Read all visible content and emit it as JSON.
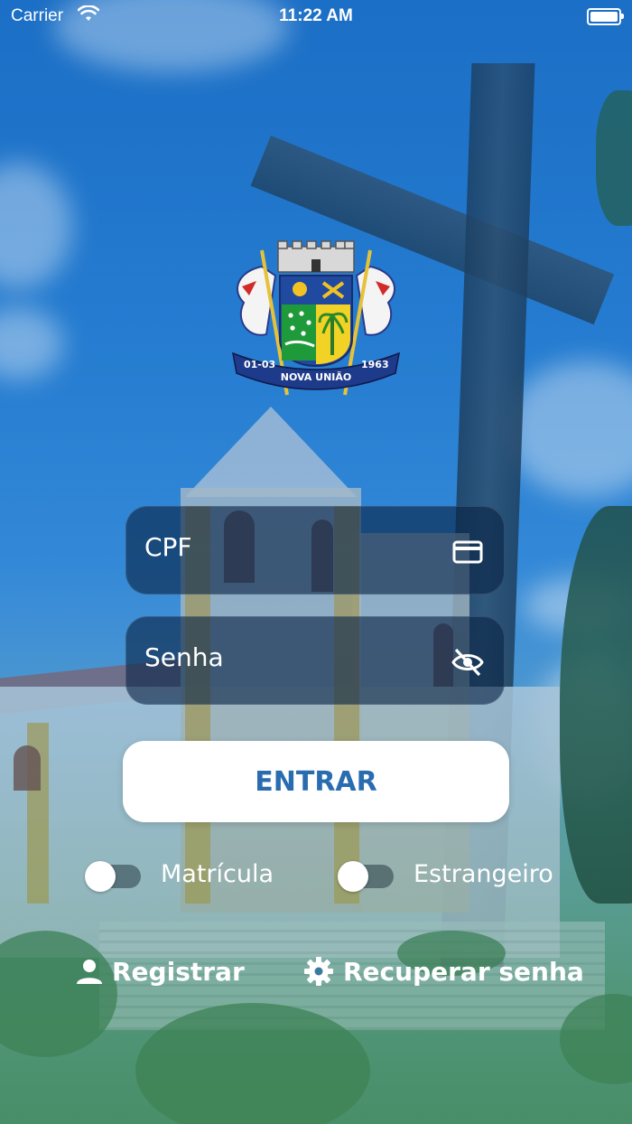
{
  "status_bar": {
    "carrier": "Carrier",
    "time": "11:22 AM",
    "wifi_icon": "wifi-icon",
    "battery_icon": "battery-icon"
  },
  "crest": {
    "icon": "municipal-crest",
    "text_left": "01-03",
    "text_center": "NOVA UNIÃO",
    "text_right": "1963"
  },
  "form": {
    "cpf": {
      "label": "CPF",
      "icon": "id-card-icon"
    },
    "senha": {
      "label": "Senha",
      "icon": "eye-off-icon"
    },
    "submit_label": "ENTRAR"
  },
  "toggles": [
    {
      "label": "Matrícula",
      "on": false
    },
    {
      "label": "Estrangeiro",
      "on": false
    }
  ],
  "links": {
    "registrar": {
      "label": "Registrar",
      "icon": "person-icon"
    },
    "recuperar": {
      "label": "Recuperar senha",
      "icon": "gear-icon"
    }
  },
  "colors": {
    "button_text": "#2a6cb0",
    "field_bg": "#0a2346"
  }
}
